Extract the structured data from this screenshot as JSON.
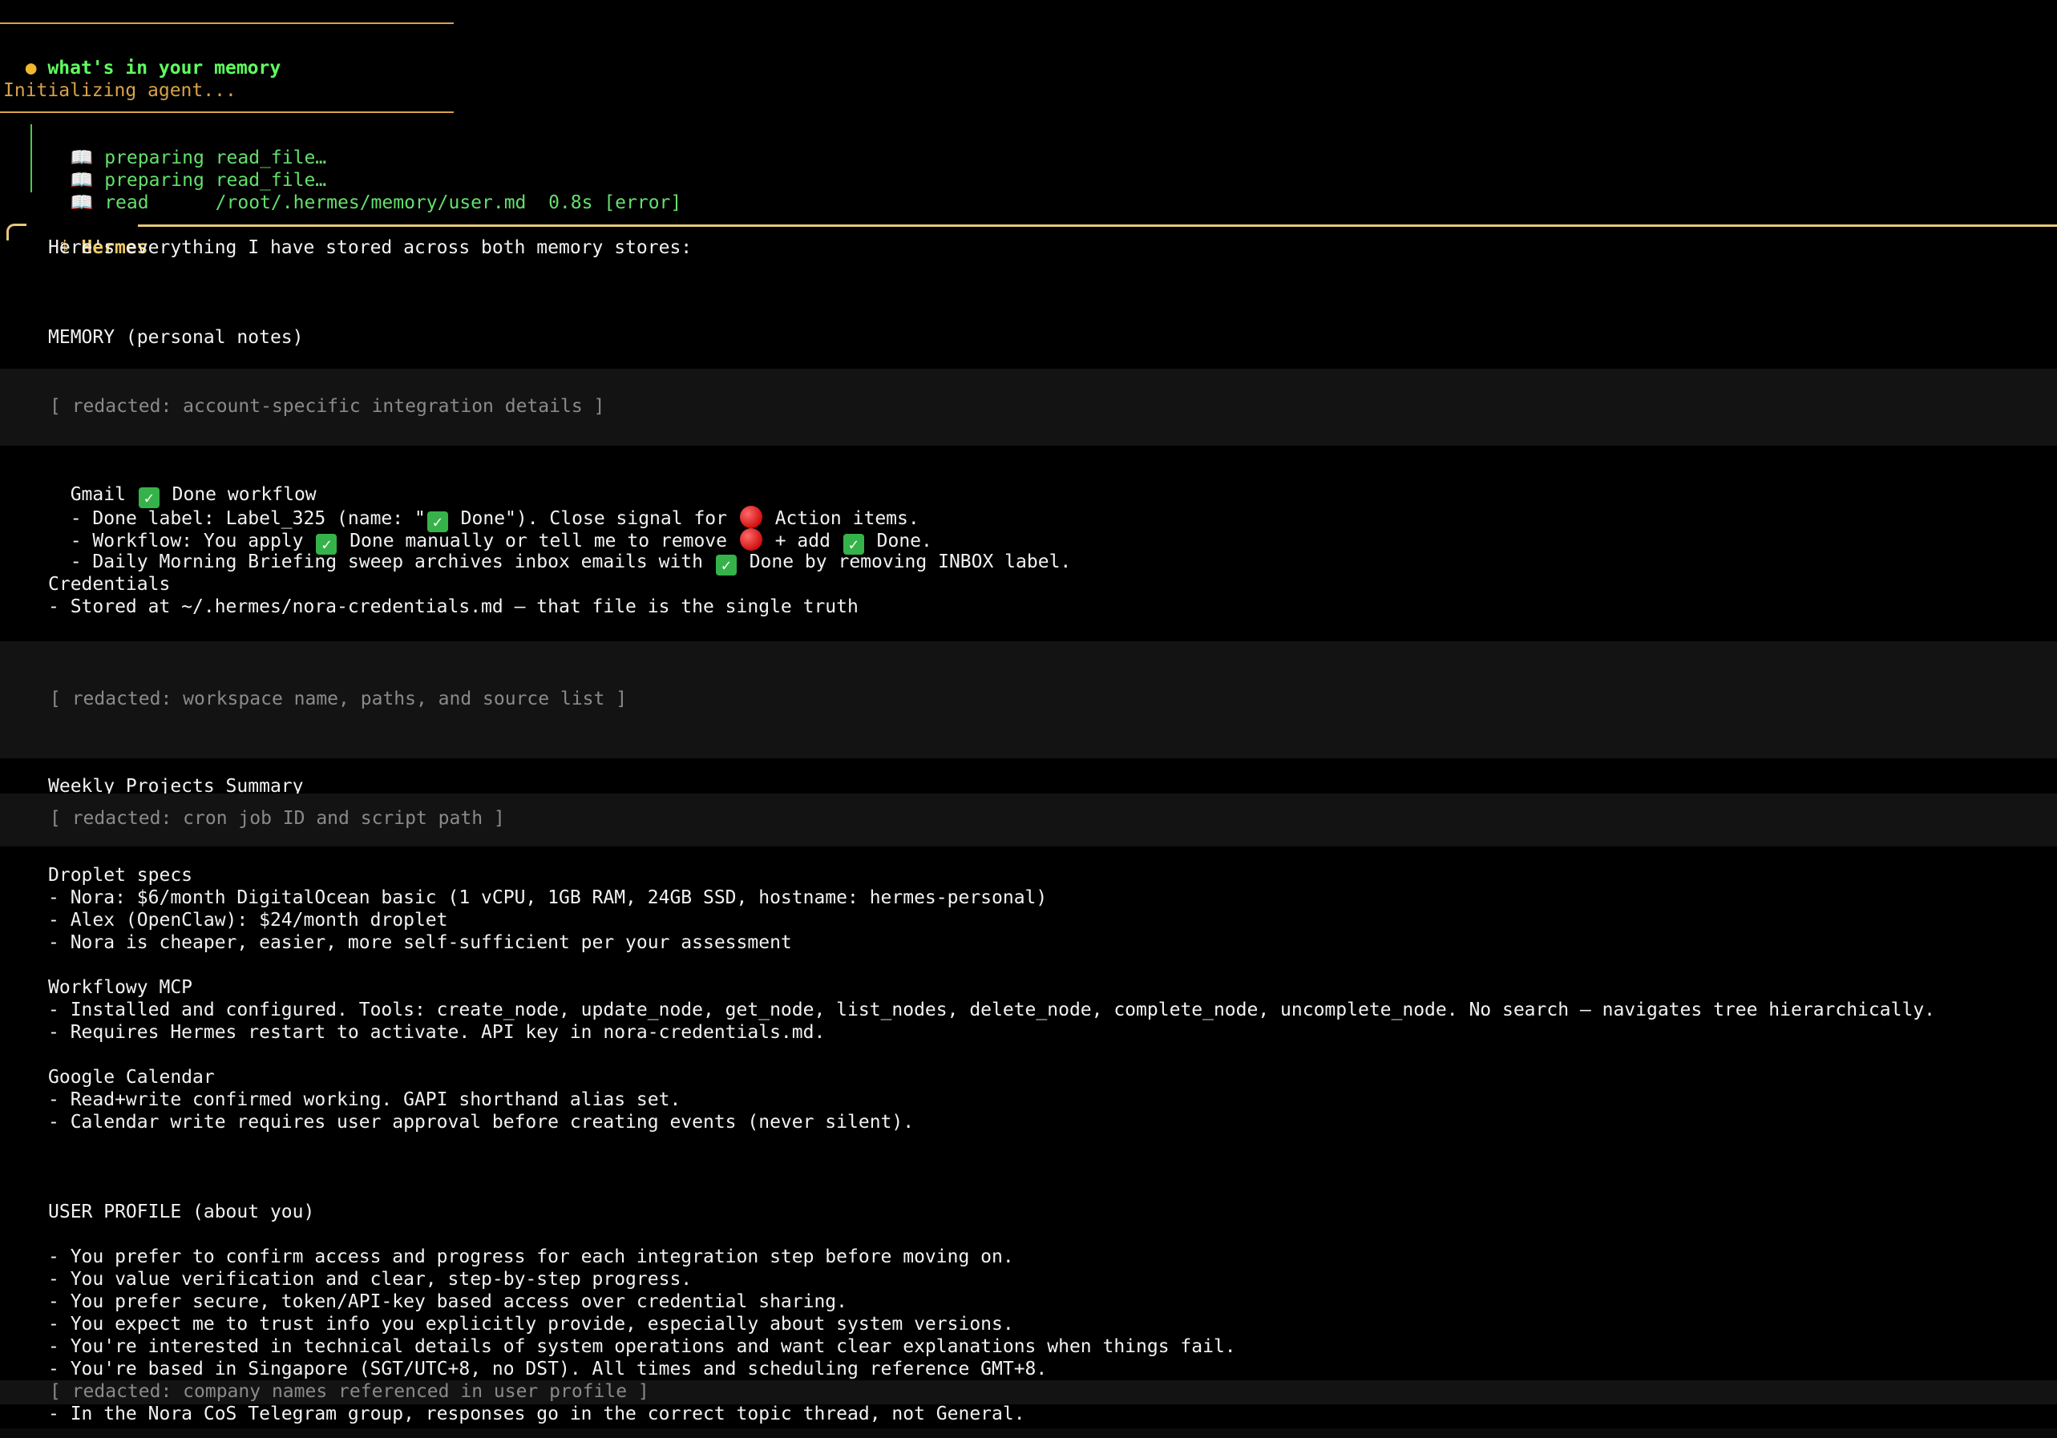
{
  "header": {
    "bullet": "●",
    "prompt": "what's in your memory",
    "initializing": "Initializing agent..."
  },
  "tools": [
    {
      "icon": "📖",
      "text": "preparing read_file…"
    },
    {
      "icon": "📖",
      "text": "preparing read_file…"
    },
    {
      "icon": "📖",
      "text": "read      /root/.hermes/memory/user.md  0.8s [error]"
    }
  ],
  "agent": {
    "icon": "⚕",
    "name": "Hermes",
    "intro": "Here's everything I have stored across both memory stores:"
  },
  "memory": {
    "heading": "MEMORY (personal notes)",
    "redacted_1": "[ redacted: account-specific integration details ]",
    "gmail_title_pre": "Gmail ",
    "gmail_title_post": " Done workflow",
    "gmail_l1_a": "- Done label: Label_325 (name: \"",
    "gmail_l1_b": " Done\"). Close signal for ",
    "gmail_l1_c": " Action items.",
    "gmail_l2_a": "- Workflow: You apply ",
    "gmail_l2_b": " Done manually or tell me to remove ",
    "gmail_l2_c": " + add ",
    "gmail_l2_d": " Done.",
    "gmail_l3_a": "- Daily Morning Briefing sweep archives inbox emails with ",
    "gmail_l3_b": " Done by removing INBOX label.",
    "credentials_title": "Credentials",
    "credentials_l1": "- Stored at ~/.hermes/nora-credentials.md — that file is the single truth",
    "redacted_2": "[ redacted: workspace name, paths, and source list ]",
    "weekly_title": "Weekly Projects Summary",
    "redacted_3": "[ redacted: cron job ID and script path ]",
    "droplet_title": "Droplet specs",
    "droplet_l1": "- Nora: $6/month DigitalOcean basic (1 vCPU, 1GB RAM, 24GB SSD, hostname: hermes-personal)",
    "droplet_l2": "- Alex (OpenClaw): $24/month droplet",
    "droplet_l3": "- Nora is cheaper, easier, more self-sufficient per your assessment",
    "workflowy_title": "Workflowy MCP",
    "workflowy_l1": "- Installed and configured. Tools: create_node, update_node, get_node, list_nodes, delete_node, complete_node, uncomplete_node. No search — navigates tree hierarchically.",
    "workflowy_l2": "- Requires Hermes restart to activate. API key in nora-credentials.md.",
    "gcal_title": "Google Calendar",
    "gcal_l1": "- Read+write confirmed working. GAPI shorthand alias set.",
    "gcal_l2": "- Calendar write requires user approval before creating events (never silent)."
  },
  "user_profile": {
    "heading": "USER PROFILE (about you)",
    "lines": [
      "- You prefer to confirm access and progress for each integration step before moving on.",
      "- You value verification and clear, step-by-step progress.",
      "- You prefer secure, token/API-key based access over credential sharing.",
      "- You expect me to trust info you explicitly provide, especially about system versions.",
      "- You're interested in technical details of system operations and want clear explanations when things fail.",
      "- You're based in Singapore (SGT/UTC+8, no DST). All times and scheduling reference GMT+8."
    ],
    "redacted_4": "[ redacted: company names referenced in user profile ]",
    "last_line": "- In the Nora CoS Telegram group, responses go in the correct topic thread, not General."
  },
  "colors": {
    "background": "#000000",
    "prompt_green": "#5fff5f",
    "tool_green": "#63e06b",
    "orange": "#d9a24a",
    "hermes_gold": "#f0cd6a",
    "redacted_gray": "#8a8a8a"
  }
}
